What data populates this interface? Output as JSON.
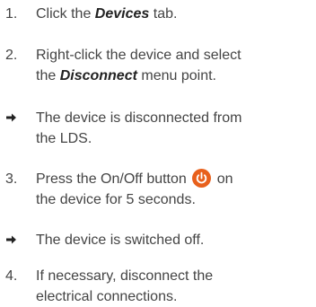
{
  "steps": [
    {
      "marker": "1.",
      "before": "Click the ",
      "emphasis": "Devices",
      "after": " tab."
    },
    {
      "marker": "2.",
      "line1": "Right-click the device and select",
      "before": "the ",
      "emphasis": "Disconnect",
      "after": " menu point."
    },
    {
      "marker_icon": "right-arrow-icon",
      "line1": "The device is disconnected from",
      "line2": "the LDS."
    },
    {
      "marker": "3.",
      "before": "Press the On/Off button ",
      "icon": "power-button-icon",
      "after": " on",
      "line2": "the device for 5 seconds."
    },
    {
      "marker_icon": "right-arrow-icon",
      "line1": "The device is switched off."
    },
    {
      "marker": "4.",
      "line1": "If necessary, disconnect the",
      "line2": "electrical connections."
    }
  ],
  "colors": {
    "text": "#444444",
    "emphasis": "#222222",
    "power_button": "#E8601C",
    "power_glyph": "#ffffff"
  }
}
